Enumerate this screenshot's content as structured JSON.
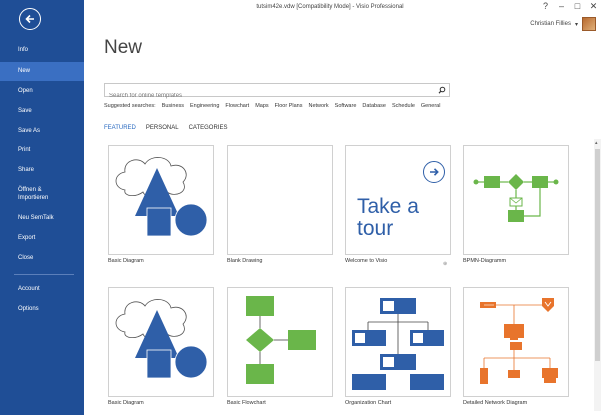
{
  "window": {
    "title": "tutsim42e.vdw  [Compatibility Mode] - Visio Professional",
    "help": "?",
    "minimize": "–",
    "restore": "□",
    "close": "✕",
    "user_name": "Christian Fillies",
    "user_dropdown": "▾"
  },
  "sidebar": {
    "items": [
      {
        "label": "Info"
      },
      {
        "label": "New"
      },
      {
        "label": "Open"
      },
      {
        "label": "Save"
      },
      {
        "label": "Save As"
      },
      {
        "label": "Print"
      },
      {
        "label": "Share"
      },
      {
        "label": "Öffnen & Importieren"
      },
      {
        "label": "Neu SemTalk"
      },
      {
        "label": "Export"
      },
      {
        "label": "Close"
      },
      {
        "label": "Account"
      },
      {
        "label": "Options"
      }
    ]
  },
  "main": {
    "title": "New",
    "search": {
      "placeholder": "Search for online templates"
    },
    "suggested": {
      "label": "Suggested searches:",
      "items": [
        "Business",
        "Engineering",
        "Flowchart",
        "Maps",
        "Floor Plans",
        "Network",
        "Software",
        "Database",
        "Schedule",
        "General"
      ]
    },
    "tabs": [
      "FEATURED",
      "PERSONAL",
      "CATEGORIES"
    ],
    "templates": [
      {
        "label": "Basic Diagram"
      },
      {
        "label": "Blank Drawing"
      },
      {
        "label": "Welcome to Visio",
        "tour_line1": "Take a",
        "tour_line2": "tour"
      },
      {
        "label": "BPMN-Diagramm"
      },
      {
        "label": "Basic Diagram"
      },
      {
        "label": "Basic Flowchart"
      },
      {
        "label": "Organization Chart"
      },
      {
        "label": "Detailed Network Diagram"
      }
    ]
  },
  "colors": {
    "sidebar": "#1f4e96",
    "sidebar_active": "#3a6fc2",
    "accent": "#2a6ac0",
    "shape_blue": "#2f5fa8",
    "flow_green": "#6ab64a",
    "network_orange": "#e8742c"
  },
  "icons": {
    "back": "back-arrow-icon",
    "search": "search-icon",
    "tour": "arrow-right-circle-icon"
  }
}
